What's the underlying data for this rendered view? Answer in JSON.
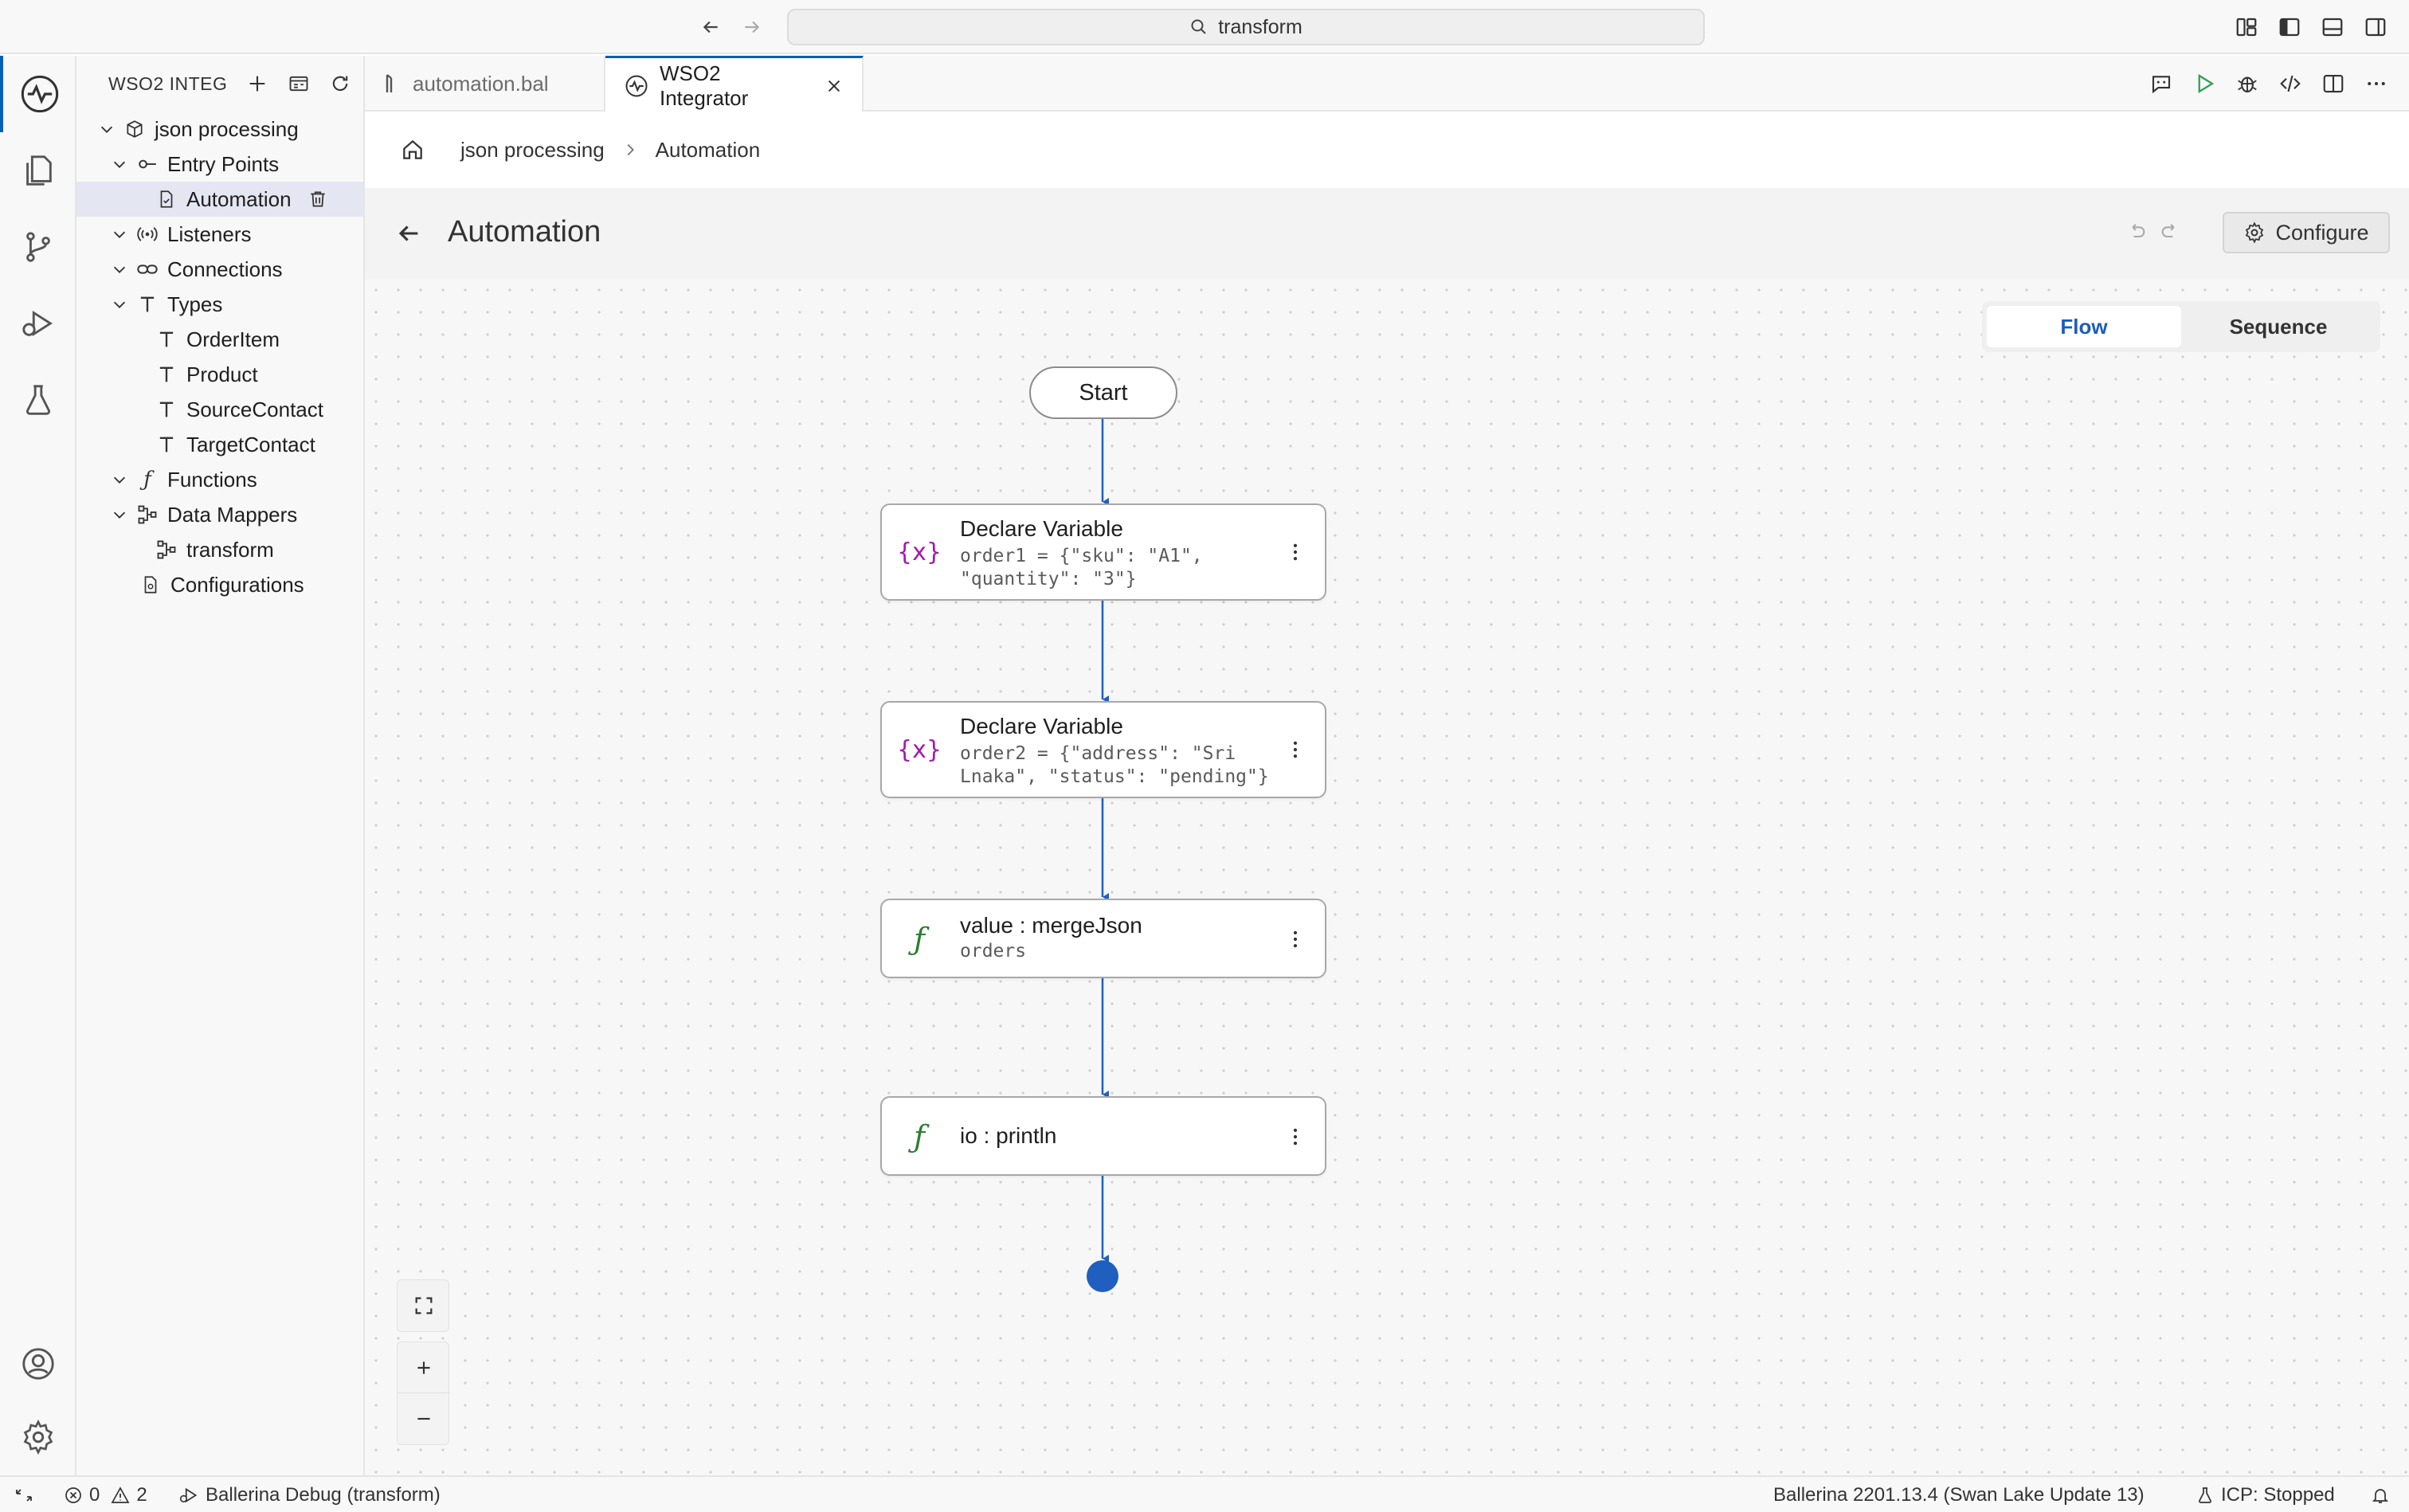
{
  "titlebar": {
    "search_text": "transform",
    "icons": [
      "back-arrow-icon",
      "forward-arrow-icon",
      "search-icon",
      "layout-customize-icon",
      "toggle-sidebar-icon",
      "toggle-panel-icon",
      "toggle-secondary-sidebar-icon"
    ]
  },
  "activitybar": {
    "items": [
      "wso2-integrator-icon",
      "explorer-icon",
      "source-control-icon",
      "run-debug-icon",
      "testing-icon"
    ],
    "bottom_items": [
      "account-icon",
      "settings-icon"
    ]
  },
  "sidebar": {
    "title": "WSO2 INTEGRATOR",
    "tree": {
      "project": "json processing",
      "entry_points": "Entry Points",
      "automation": "Automation",
      "listeners": "Listeners",
      "connections": "Connections",
      "types": "Types",
      "type_items": [
        "OrderItem",
        "Product",
        "SourceContact",
        "TargetContact"
      ],
      "functions": "Functions",
      "data_mappers": "Data Mappers",
      "transform": "transform",
      "configurations": "Configurations"
    }
  },
  "tabs": {
    "tab1": "automation.bal",
    "tab2": "WSO2 Integrator"
  },
  "breadcrumb": {
    "project": "json processing",
    "current": "Automation"
  },
  "header": {
    "title": "Automation",
    "configure_label": "Configure"
  },
  "view_toggle": {
    "flow": "Flow",
    "sequence": "Sequence",
    "selected": "Flow"
  },
  "flow": {
    "start_label": "Start",
    "nodes": [
      {
        "title": "Declare Variable",
        "desc": "order1 = {\"sku\": \"A1\", \"quantity\": \"3\"}",
        "icon": "variable-icon"
      },
      {
        "title": "Declare Variable",
        "desc": "order2 = {\"address\": \"Sri Lnaka\", \"status\": \"pending\"}",
        "icon": "variable-icon"
      },
      {
        "title": "value : mergeJson",
        "desc": "orders",
        "icon": "function-icon"
      },
      {
        "title": "io : println",
        "desc": "",
        "icon": "function-icon"
      }
    ]
  },
  "colors": {
    "accent": "#005fb8",
    "flow_line": "#1f5fbf",
    "variable_icon": "#a21caf",
    "function_icon": "#2e7d32"
  },
  "statusbar": {
    "errors": "0",
    "warnings": "2",
    "debug_label": "Ballerina Debug (transform)",
    "version": "Ballerina 2201.13.4 (Swan Lake Update 13)",
    "icp": "ICP: Stopped"
  }
}
